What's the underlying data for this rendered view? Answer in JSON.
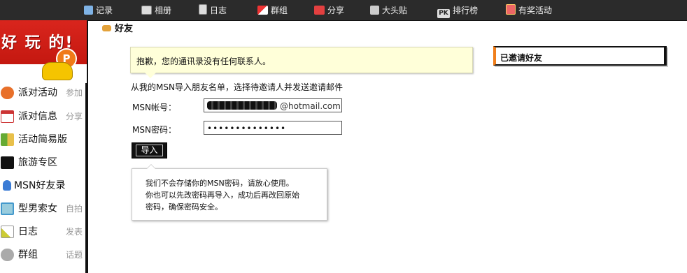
{
  "topnav": {
    "items": [
      {
        "label": "记录",
        "icon": "chat-bubble-icon"
      },
      {
        "label": "相册",
        "icon": "camera-icon"
      },
      {
        "label": "日志",
        "icon": "document-icon"
      },
      {
        "label": "群组",
        "icon": "group-flag-icon"
      },
      {
        "label": "分享",
        "icon": "heart-share-icon"
      },
      {
        "label": "大头贴",
        "icon": "face-icon"
      },
      {
        "label": "排行榜",
        "icon": "pk-icon",
        "icon_text": "PK"
      },
      {
        "label": "有奖活动",
        "icon": "gift-icon"
      }
    ]
  },
  "sidebar": {
    "banner_text": "好 玩 的!",
    "banner_badge": "P",
    "items": [
      {
        "label": "派对活动",
        "extra": "参加",
        "icon": "party-people-icon",
        "color": "#e8702a"
      },
      {
        "label": "派对信息",
        "extra": "分享",
        "icon": "calendar-icon",
        "color": "#c33"
      },
      {
        "label": "活动简易版",
        "extra": "",
        "icon": "map-icon",
        "color": "#6a3"
      },
      {
        "label": "旅游专区",
        "extra": "",
        "icon": "bicycle-icon",
        "color": "#111"
      },
      {
        "label": "MSN好友录",
        "extra": "",
        "icon": "msn-user-icon",
        "color": "#3a7bd5"
      },
      {
        "label": "型男索女",
        "extra": "自拍",
        "icon": "photo-frame-icon",
        "color": "#49c"
      },
      {
        "label": "日志",
        "extra": "发表",
        "icon": "pencil-note-icon",
        "color": "#cc3"
      },
      {
        "label": "群组",
        "extra": "话题",
        "icon": "group-icon",
        "color": "#777"
      }
    ]
  },
  "main": {
    "title": "好友",
    "notice": "抱歉，您的通讯录没有任何联系人。",
    "instruction": "从我的MSN导入朋友名单，选择待邀请人并发送邀请邮件",
    "msn_account_label": "MSN帐号：",
    "msn_account_value": "@hotmail.com",
    "msn_password_label": "MSN密码：",
    "msn_password_value": "••••••••••••••",
    "import_button": "导入",
    "tip_lines": [
      "我们不会存储你的MSN密码，请放心使用。",
      "你也可以先改密码再导入，成功后再改回原始",
      "密码，确保密码安全。"
    ]
  },
  "right_panel": {
    "invited_title": "已邀请好友"
  }
}
